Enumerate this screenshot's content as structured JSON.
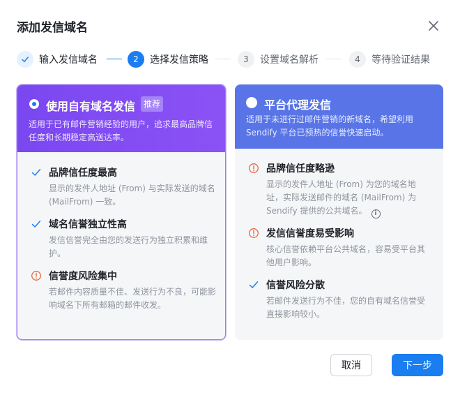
{
  "dialog": {
    "title": "添加发信域名"
  },
  "steps": [
    {
      "number": "1",
      "label": "输入发信域名",
      "state": "done"
    },
    {
      "number": "2",
      "label": "选择发信策略",
      "state": "active"
    },
    {
      "number": "3",
      "label": "设置域名解析",
      "state": "todo"
    },
    {
      "number": "4",
      "label": "等待验证结果",
      "state": "todo"
    }
  ],
  "options": {
    "own": {
      "title": "使用自有域名发信",
      "badge": "推荐",
      "selected": true,
      "description": "适用于已有邮件营销经验的用户，追求最高品牌信任度和长期稳定高送达率。",
      "features": [
        {
          "icon": "check-icon",
          "title": "品牌信任度最高",
          "desc": "显示的发件人地址 (From) 与实际发送的域名 (MailFrom) 一致。"
        },
        {
          "icon": "check-icon",
          "title": "域名信誉独立性高",
          "desc": "发信信誉完全由您的发送行为独立积累和维护。"
        },
        {
          "icon": "warning-icon",
          "title": "信誉度风险集中",
          "desc": "若邮件内容质量不佳、发送行为不良，可能影响域名下所有邮箱的邮件收发。"
        }
      ]
    },
    "platform": {
      "title": "平台代理发信",
      "selected": false,
      "description": "适用于未进行过邮件营销的新域名，希望利用 Sendify 平台已预热的信誉快速启动。",
      "features": [
        {
          "icon": "warning-icon",
          "title": "品牌信任度略逊",
          "desc": "显示的发件人地址 (From) 为您的域名地址，实际发送邮件的域名 (MailFrom) 为 Sendify 提供的公共域名。",
          "info": "i"
        },
        {
          "icon": "warning-icon",
          "title": "发信信誉度易受影响",
          "desc": "核心信誉依赖平台公共域名，容易受平台其他用户影响。"
        },
        {
          "icon": "check-icon",
          "title": "信誉风险分散",
          "desc": "若邮件发送行为不佳，您的自有域名信誉受直接影响较小。"
        }
      ]
    }
  },
  "footer": {
    "cancel_label": "取消",
    "next_label": "下一步"
  },
  "colors": {
    "primary": "#1a7df0",
    "own_header": "#7a47f0",
    "platform_header": "#5874e6",
    "warning": "#f0643c",
    "check": "#1a7df0"
  }
}
